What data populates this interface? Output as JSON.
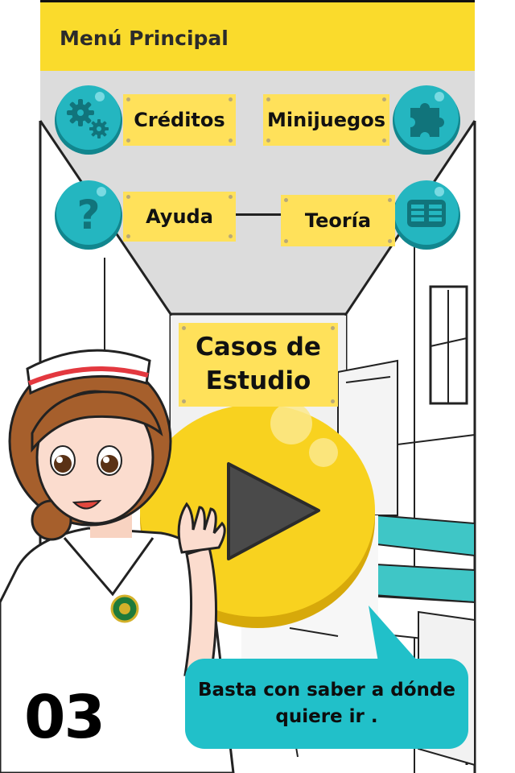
{
  "header": {
    "title": "Menú Principal"
  },
  "menu": {
    "creditos": {
      "label": "Créditos",
      "icon": "gears-icon"
    },
    "minijuegos": {
      "label": "Minijuegos",
      "icon": "puzzle-icon"
    },
    "ayuda": {
      "label": "Ayuda",
      "icon": "question-icon"
    },
    "teoria": {
      "label": "Teoría",
      "icon": "book-icon"
    },
    "casos": {
      "line1": "Casos de",
      "line2": "Estudio",
      "icon": "play-icon"
    }
  },
  "bubble": {
    "line1": "Basta con saber a dónde",
    "line2": "quiere ir ."
  },
  "step_number": "03",
  "colors": {
    "header_yellow": "#fadb2c",
    "label_yellow": "#ffe15a",
    "teal": "#21c0c9",
    "play_yellow": "#f8d21f"
  }
}
